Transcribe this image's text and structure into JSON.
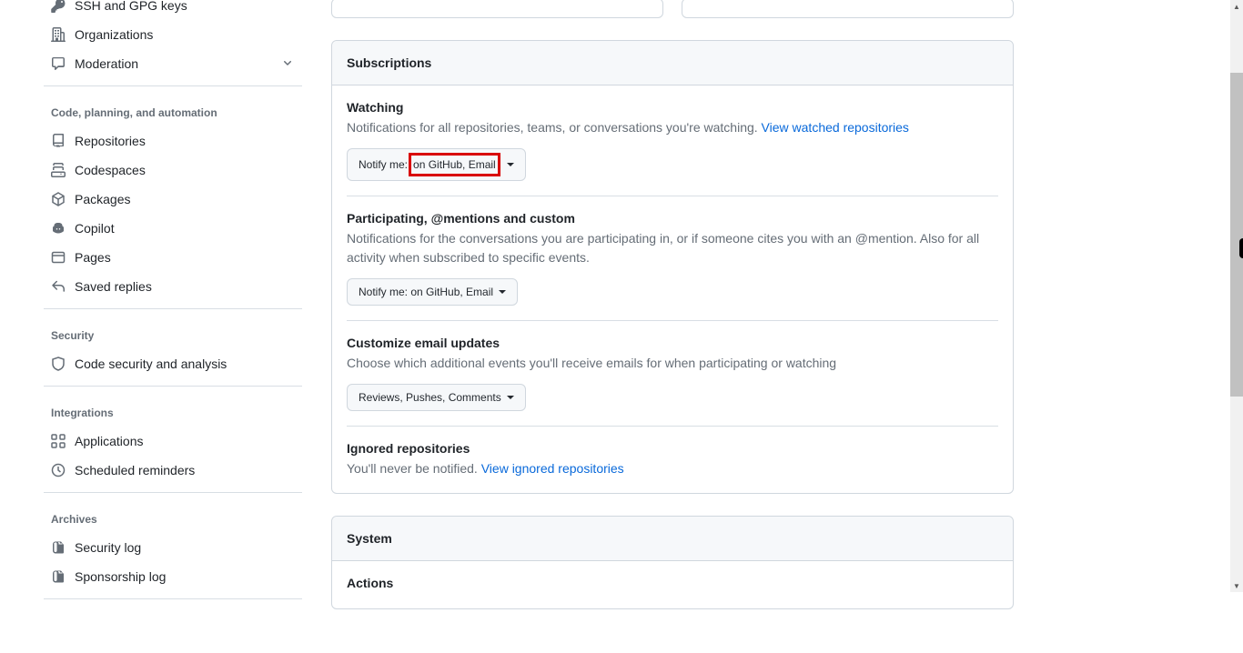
{
  "sidebar": {
    "item_ssh": "SSH and GPG keys",
    "item_org": "Organizations",
    "item_mod": "Moderation",
    "heading_code": "Code, planning, and automation",
    "item_repos": "Repositories",
    "item_codespaces": "Codespaces",
    "item_packages": "Packages",
    "item_copilot": "Copilot",
    "item_pages": "Pages",
    "item_saved": "Saved replies",
    "heading_security": "Security",
    "item_codesec": "Code security and analysis",
    "heading_integrations": "Integrations",
    "item_apps": "Applications",
    "item_sched": "Scheduled reminders",
    "heading_archives": "Archives",
    "item_seclog": "Security log",
    "item_sponslog": "Sponsorship log"
  },
  "subscriptions": {
    "header": "Subscriptions",
    "watching": {
      "title": "Watching",
      "desc": "Notifications for all repositories, teams, or conversations you're watching. ",
      "link": "View watched repositories",
      "btn_prefix": "Notify me:",
      "btn_value": "on GitHub, Email"
    },
    "participating": {
      "title": "Participating, @mentions and custom",
      "desc": "Notifications for the conversations you are participating in, or if someone cites you with an @mention. Also for all activity when subscribed to specific events.",
      "btn": "Notify me: on GitHub, Email"
    },
    "customize": {
      "title": "Customize email updates",
      "desc": "Choose which additional events you'll receive emails for when participating or watching",
      "btn": "Reviews, Pushes, Comments"
    },
    "ignored": {
      "title": "Ignored repositories",
      "desc": "You'll never be notified. ",
      "link": "View ignored repositories"
    }
  },
  "system": {
    "header": "System",
    "actions_title": "Actions"
  }
}
